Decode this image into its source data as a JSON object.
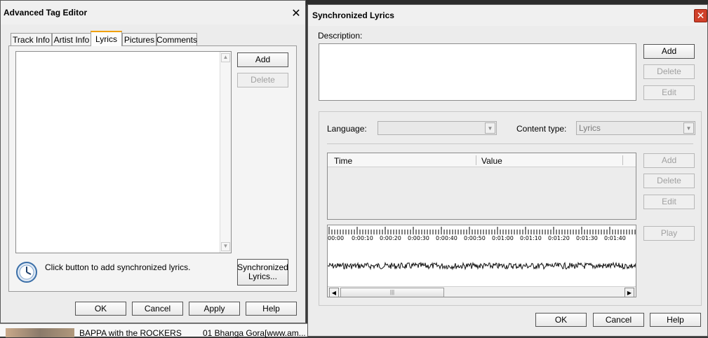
{
  "tag_editor": {
    "title": "Advanced Tag Editor",
    "tabs": [
      "Track Info",
      "Artist Info",
      "Lyrics",
      "Pictures",
      "Comments"
    ],
    "active_tab": "Lyrics",
    "add_label": "Add",
    "delete_label": "Delete",
    "hint_text": "Click button to add synchronized lyrics.",
    "sync_button_label": "Synchronized Lyrics...",
    "ok_label": "OK",
    "cancel_label": "Cancel",
    "apply_label": "Apply",
    "help_label": "Help"
  },
  "background_list": {
    "artist": "BAPPA with the ROCKERS",
    "track": "01 Bhanga Gora[www.am..."
  },
  "sync_lyrics": {
    "title": "Synchronized Lyrics",
    "description_label": "Description:",
    "description_value": "",
    "add_label": "Add",
    "delete_label": "Delete",
    "edit_label": "Edit",
    "language_label": "Language:",
    "language_value": "",
    "content_type_label": "Content type:",
    "content_type_value": "Lyrics",
    "table_headers": [
      "Time",
      "Value"
    ],
    "table_rows": [],
    "list_add_label": "Add",
    "list_delete_label": "Delete",
    "list_edit_label": "Edit",
    "play_label": "Play",
    "timeline_labels": [
      "00:00",
      "0:00:10",
      "0:00:20",
      "0:00:30",
      "0:00:40",
      "0:00:50",
      "0:01:00",
      "0:01:10",
      "0:01:20",
      "0:01:30",
      "0:01:40"
    ],
    "ok_label": "OK",
    "cancel_label": "Cancel",
    "help_label": "Help"
  },
  "colors": {
    "titlebar_bg": "#f0f0f0",
    "window_bg": "#ececec",
    "close_red": "#d0402a",
    "active_tab_accent": "#f0a000"
  }
}
